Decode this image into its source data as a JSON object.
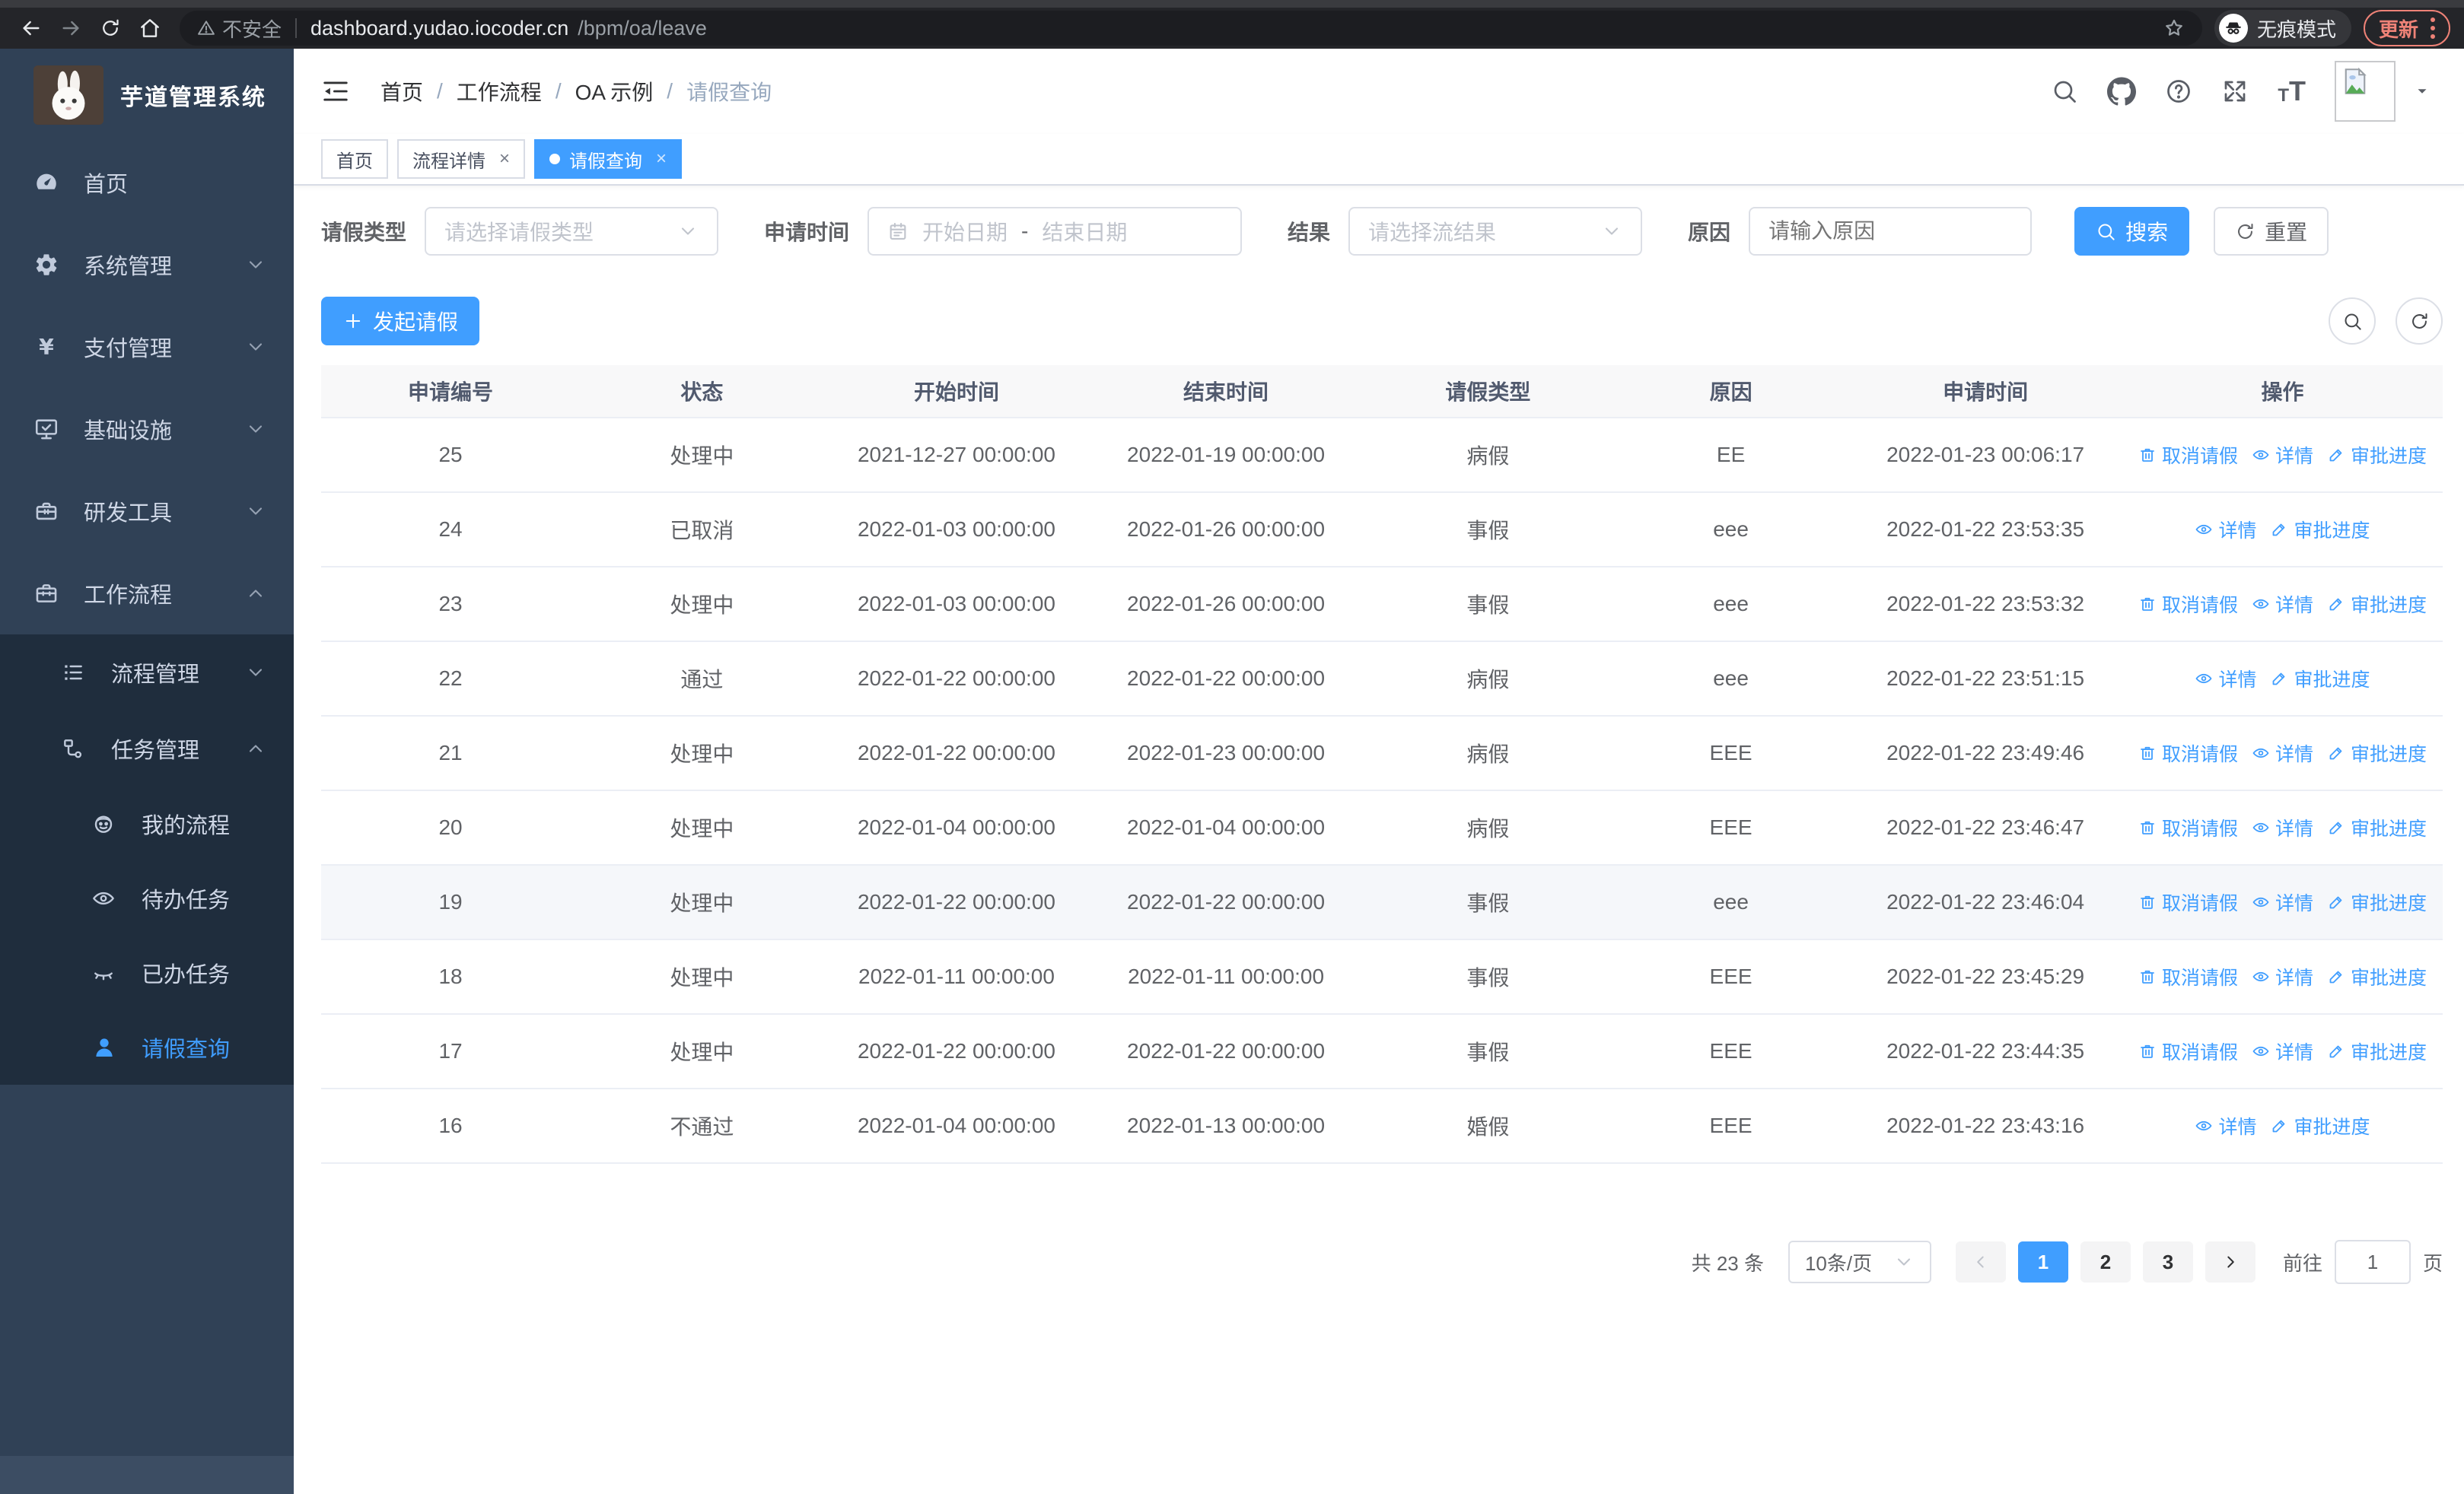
{
  "browser": {
    "nav_icons": [
      "back-icon",
      "forward-icon",
      "reload-icon",
      "home-icon"
    ],
    "security_label": "不安全",
    "url_host": "dashboard.yudao.iocoder.cn",
    "url_path": "/bpm/oa/leave",
    "incognito_label": "无痕模式",
    "update_label": "更新"
  },
  "sidebar": {
    "title": "芋道管理系统",
    "items": [
      {
        "key": "home",
        "label": "首页",
        "icon": "dashboard-icon",
        "depth": 0
      },
      {
        "key": "system",
        "label": "系统管理",
        "icon": "gear-icon",
        "depth": 0,
        "chevron": "down"
      },
      {
        "key": "payment",
        "label": "支付管理",
        "icon": "yen-icon",
        "depth": 0,
        "chevron": "down"
      },
      {
        "key": "infra",
        "label": "基础设施",
        "icon": "monitor-icon",
        "depth": 0,
        "chevron": "down"
      },
      {
        "key": "devtools",
        "label": "研发工具",
        "icon": "toolbox-icon",
        "depth": 0,
        "chevron": "down"
      },
      {
        "key": "workflow",
        "label": "工作流程",
        "icon": "briefcase-icon",
        "depth": 0,
        "chevron": "up"
      },
      {
        "key": "process-mgmt",
        "label": "流程管理",
        "icon": "list-icon",
        "depth": 1,
        "chevron": "down",
        "submenu": true
      },
      {
        "key": "task-mgmt",
        "label": "任务管理",
        "icon": "flow-icon",
        "depth": 1,
        "chevron": "up",
        "submenu": true
      },
      {
        "key": "my-process",
        "label": "我的流程",
        "icon": "robot-icon",
        "depth": 2,
        "submenu": true
      },
      {
        "key": "todo-task",
        "label": "待办任务",
        "icon": "eye-icon",
        "depth": 2,
        "submenu": true
      },
      {
        "key": "done-task",
        "label": "已办任务",
        "icon": "eye-off-icon",
        "depth": 2,
        "submenu": true
      },
      {
        "key": "leave-query",
        "label": "请假查询",
        "icon": "user-icon",
        "depth": 2,
        "submenu": true,
        "active": true
      }
    ]
  },
  "header": {
    "breadcrumb": [
      "首页",
      "工作流程",
      "OA 示例",
      "请假查询"
    ],
    "icons": [
      "search-icon",
      "github-icon",
      "help-icon",
      "fullscreen-icon",
      "font-size-icon"
    ]
  },
  "tabs": [
    {
      "key": "home",
      "label": "首页",
      "closable": false,
      "active": false
    },
    {
      "key": "process-detail",
      "label": "流程详情",
      "closable": true,
      "active": false
    },
    {
      "key": "leave-query",
      "label": "请假查询",
      "closable": true,
      "active": true
    }
  ],
  "filters": {
    "leave_type_label": "请假类型",
    "leave_type_placeholder": "请选择请假类型",
    "apply_time_label": "申请时间",
    "date_start_placeholder": "开始日期",
    "date_separator": "-",
    "date_end_placeholder": "结束日期",
    "result_label": "结果",
    "result_placeholder": "请选择流结果",
    "reason_label": "原因",
    "reason_placeholder": "请输入原因",
    "search_label": "搜索",
    "reset_label": "重置"
  },
  "toolbar": {
    "create_label": "发起请假"
  },
  "table": {
    "columns": [
      "申请编号",
      "状态",
      "开始时间",
      "结束时间",
      "请假类型",
      "原因",
      "申请时间",
      "操作"
    ],
    "action_defs": {
      "cancel": {
        "label": "取消请假",
        "icon": "delete-icon"
      },
      "detail": {
        "label": "详情",
        "icon": "view-icon"
      },
      "progress": {
        "label": "审批进度",
        "icon": "edit-icon"
      }
    },
    "rows": [
      {
        "id": "25",
        "status": "处理中",
        "start": "2021-12-27 00:00:00",
        "end": "2022-01-19 00:00:00",
        "type": "病假",
        "reason": "EE",
        "applied": "2022-01-23 00:06:17",
        "actions": [
          "cancel",
          "detail",
          "progress"
        ]
      },
      {
        "id": "24",
        "status": "已取消",
        "start": "2022-01-03 00:00:00",
        "end": "2022-01-26 00:00:00",
        "type": "事假",
        "reason": "eee",
        "applied": "2022-01-22 23:53:35",
        "actions": [
          "detail",
          "progress"
        ]
      },
      {
        "id": "23",
        "status": "处理中",
        "start": "2022-01-03 00:00:00",
        "end": "2022-01-26 00:00:00",
        "type": "事假",
        "reason": "eee",
        "applied": "2022-01-22 23:53:32",
        "actions": [
          "cancel",
          "detail",
          "progress"
        ]
      },
      {
        "id": "22",
        "status": "通过",
        "start": "2022-01-22 00:00:00",
        "end": "2022-01-22 00:00:00",
        "type": "病假",
        "reason": "eee",
        "applied": "2022-01-22 23:51:15",
        "actions": [
          "detail",
          "progress"
        ]
      },
      {
        "id": "21",
        "status": "处理中",
        "start": "2022-01-22 00:00:00",
        "end": "2022-01-23 00:00:00",
        "type": "病假",
        "reason": "EEE",
        "applied": "2022-01-22 23:49:46",
        "actions": [
          "cancel",
          "detail",
          "progress"
        ]
      },
      {
        "id": "20",
        "status": "处理中",
        "start": "2022-01-04 00:00:00",
        "end": "2022-01-04 00:00:00",
        "type": "病假",
        "reason": "EEE",
        "applied": "2022-01-22 23:46:47",
        "actions": [
          "cancel",
          "detail",
          "progress"
        ]
      },
      {
        "id": "19",
        "status": "处理中",
        "start": "2022-01-22 00:00:00",
        "end": "2022-01-22 00:00:00",
        "type": "事假",
        "reason": "eee",
        "applied": "2022-01-22 23:46:04",
        "actions": [
          "cancel",
          "detail",
          "progress"
        ],
        "highlighted": true
      },
      {
        "id": "18",
        "status": "处理中",
        "start": "2022-01-11 00:00:00",
        "end": "2022-01-11 00:00:00",
        "type": "事假",
        "reason": "EEE",
        "applied": "2022-01-22 23:45:29",
        "actions": [
          "cancel",
          "detail",
          "progress"
        ]
      },
      {
        "id": "17",
        "status": "处理中",
        "start": "2022-01-22 00:00:00",
        "end": "2022-01-22 00:00:00",
        "type": "事假",
        "reason": "EEE",
        "applied": "2022-01-22 23:44:35",
        "actions": [
          "cancel",
          "detail",
          "progress"
        ]
      },
      {
        "id": "16",
        "status": "不通过",
        "start": "2022-01-04 00:00:00",
        "end": "2022-01-13 00:00:00",
        "type": "婚假",
        "reason": "EEE",
        "applied": "2022-01-22 23:43:16",
        "actions": [
          "detail",
          "progress"
        ]
      }
    ]
  },
  "pagination": {
    "total_label": "共 23 条",
    "page_size": "10条/页",
    "pages": [
      {
        "label": "1",
        "active": true
      },
      {
        "label": "2",
        "active": false
      },
      {
        "label": "3",
        "active": false
      }
    ],
    "goto_label": "前往",
    "goto_value": "1",
    "goto_suffix": "页"
  },
  "colors": {
    "accent": "#409eff",
    "sidebar_bg": "#304156",
    "submenu_bg": "#1f2d3d",
    "update_accent": "#ee8277",
    "table_header_bg": "#f8f8f9"
  }
}
